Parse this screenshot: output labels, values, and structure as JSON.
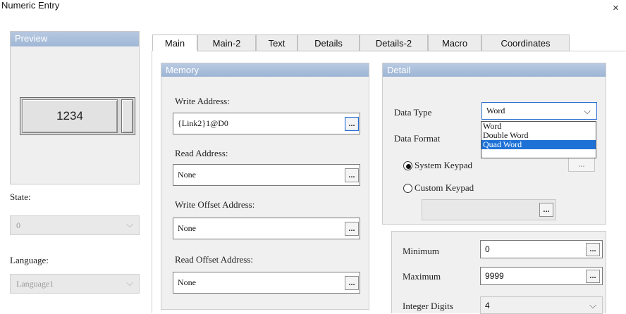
{
  "window": {
    "title": "Numeric Entry",
    "close_glyph": "×"
  },
  "preview": {
    "header": "Preview",
    "value": "1234"
  },
  "state": {
    "label": "State:",
    "value": "0"
  },
  "language": {
    "label": "Language:",
    "value": "Language1"
  },
  "tabs": [
    {
      "label": "Main",
      "active": true
    },
    {
      "label": "Main-2",
      "active": false
    },
    {
      "label": "Text",
      "active": false
    },
    {
      "label": "Details",
      "active": false
    },
    {
      "label": "Details-2",
      "active": false
    },
    {
      "label": "Macro",
      "active": false
    },
    {
      "label": "Coordinates",
      "active": false
    }
  ],
  "memory": {
    "header": "Memory",
    "write_address": {
      "label": "Write Address:",
      "value": "{Link2}1@D0"
    },
    "read_address": {
      "label": "Read Address:",
      "value": "None"
    },
    "write_offset": {
      "label": "Write Offset Address:",
      "value": "None"
    },
    "read_offset": {
      "label": "Read Offset Address:",
      "value": "None"
    },
    "browse_label": "..."
  },
  "detail": {
    "header": "Detail",
    "data_type": {
      "label": "Data Type",
      "value": "Word",
      "options": [
        "Word",
        "Double Word",
        "Quad Word"
      ],
      "highlighted": "Quad Word"
    },
    "data_format": {
      "label": "Data Format"
    },
    "system_keypad": {
      "label": "System Keypad",
      "checked": true
    },
    "custom_keypad": {
      "label": "Custom Keypad",
      "checked": false
    },
    "browse_label": "..."
  },
  "limits": {
    "minimum": {
      "label": "Minimum",
      "value": "0"
    },
    "maximum": {
      "label": "Maximum",
      "value": "9999"
    },
    "integer_digits": {
      "label": "Integer Digits",
      "value": "4"
    },
    "browse_label": "..."
  },
  "colors": {
    "accent": "#1e72d6",
    "header": "#a8bfdc",
    "focus": "#2b6fd3"
  }
}
